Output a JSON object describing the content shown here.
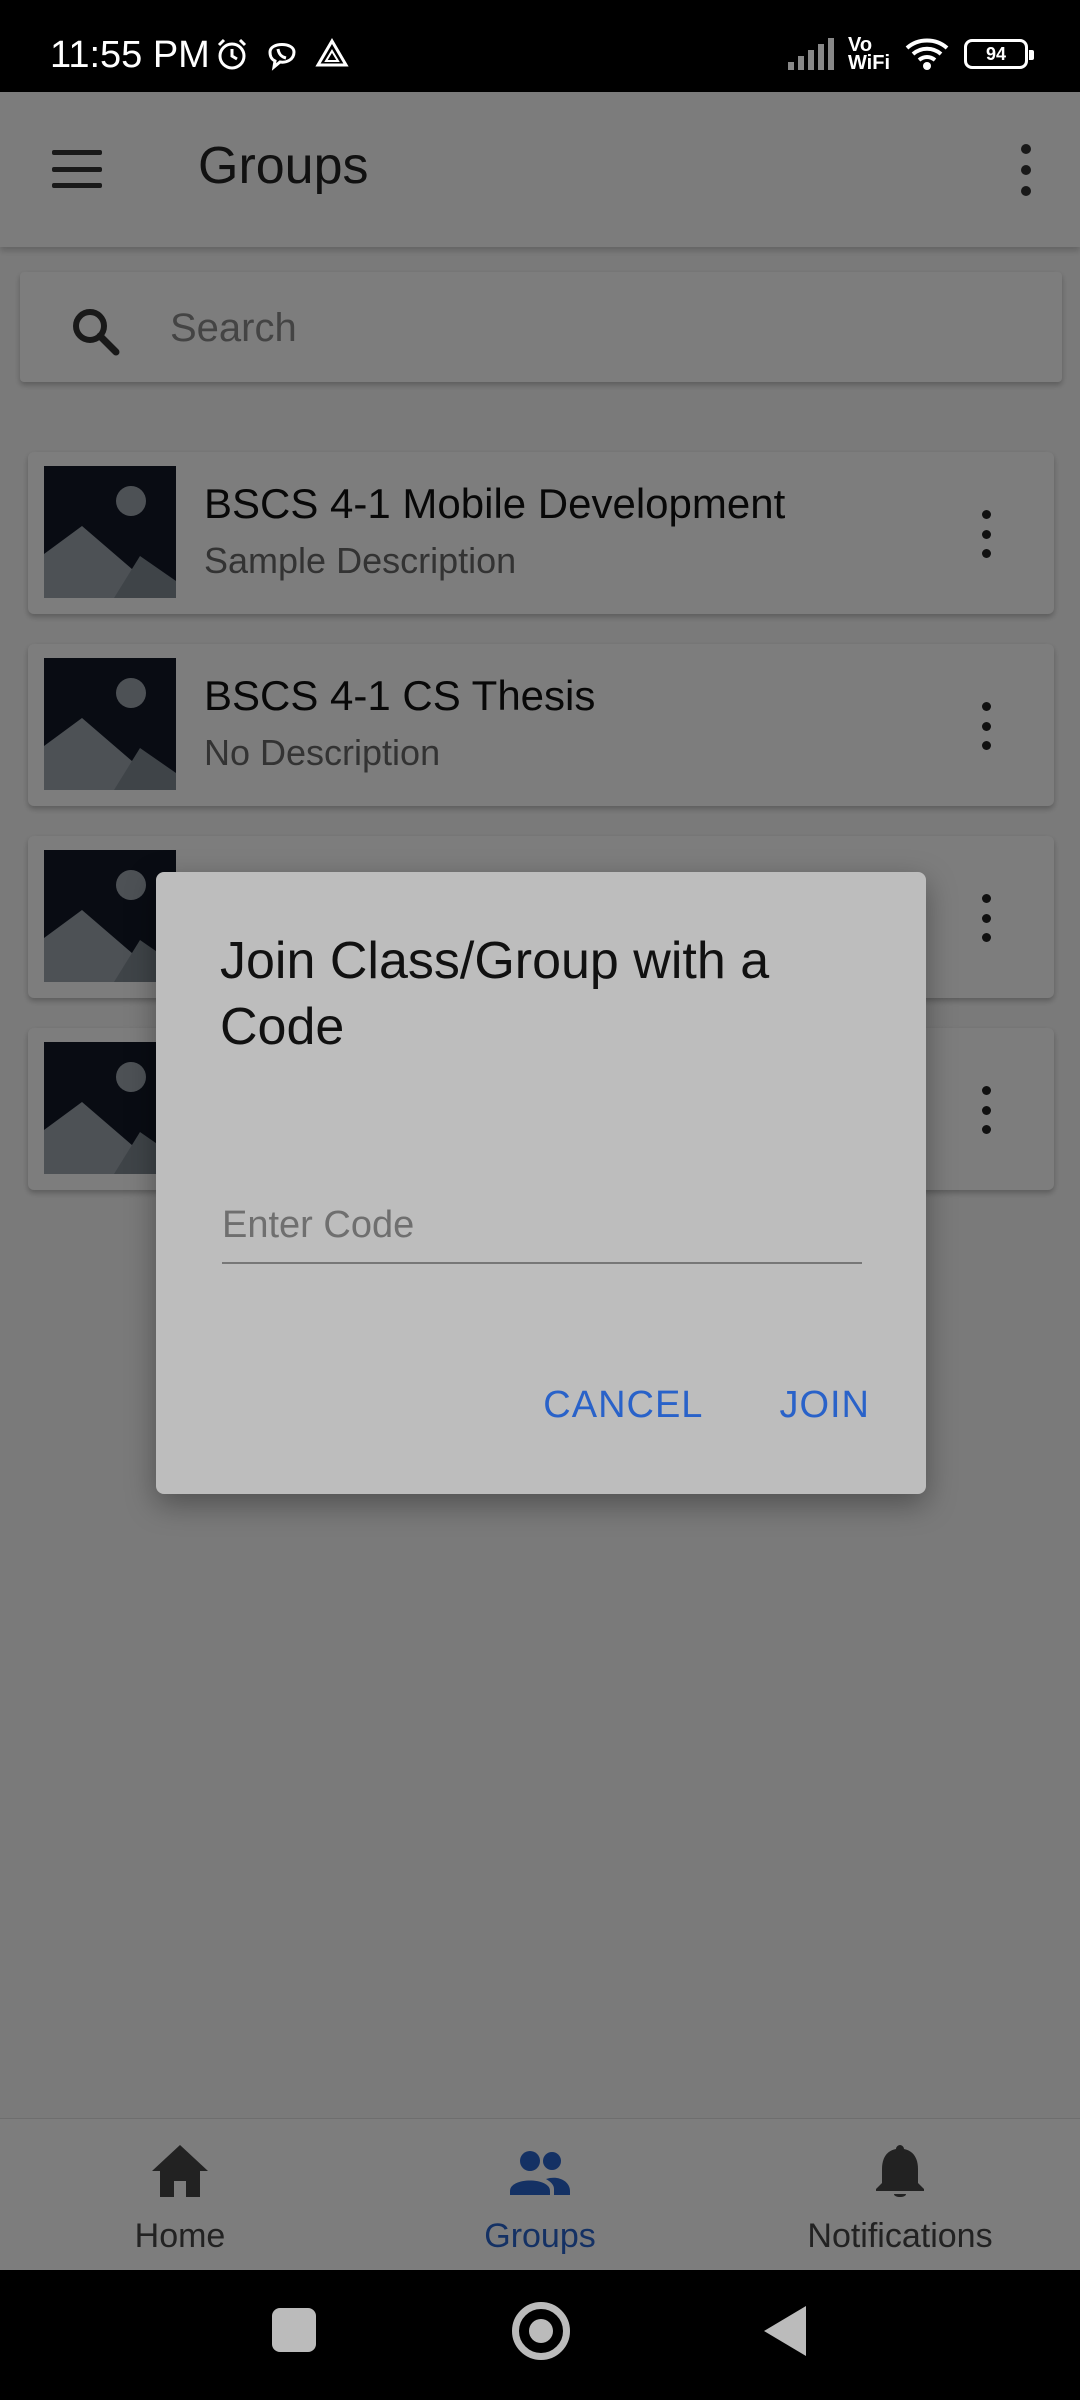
{
  "status_bar": {
    "time": "11:55 PM",
    "network_label": "Vo\nWiFi",
    "battery": "94",
    "icons_left": [
      "alarm-icon",
      "viber-icon",
      "drive-icon"
    ],
    "icons_right": [
      "signal-icon",
      "vowifi-icon",
      "wifi-icon",
      "battery-icon"
    ]
  },
  "app_bar": {
    "title": "Groups",
    "menu_icon": "hamburger-icon",
    "overflow_icon": "more-vert-icon"
  },
  "search": {
    "placeholder": "Search",
    "icon": "search-icon"
  },
  "groups": [
    {
      "title": "BSCS 4-1 Mobile Development",
      "description": "Sample Description"
    },
    {
      "title": "BSCS 4-1 CS Thesis",
      "description": "No Description"
    },
    {
      "title": "",
      "description": ""
    },
    {
      "title": "",
      "description": ""
    }
  ],
  "dialog": {
    "title": "Join Class/Group with a Code",
    "input_placeholder": "Enter Code",
    "input_value": "",
    "cancel_label": "CANCEL",
    "join_label": "JOIN"
  },
  "bottom_nav": {
    "items": [
      {
        "label": "Home",
        "icon": "home-icon",
        "active": false
      },
      {
        "label": "Groups",
        "icon": "groups-icon",
        "active": true
      },
      {
        "label": "Notifications",
        "icon": "bell-icon",
        "active": false
      }
    ]
  },
  "colors": {
    "accent": "#2962c9",
    "dialog_background": "#bdbdbd",
    "scrim": "rgba(0,0,0,0.5)"
  }
}
